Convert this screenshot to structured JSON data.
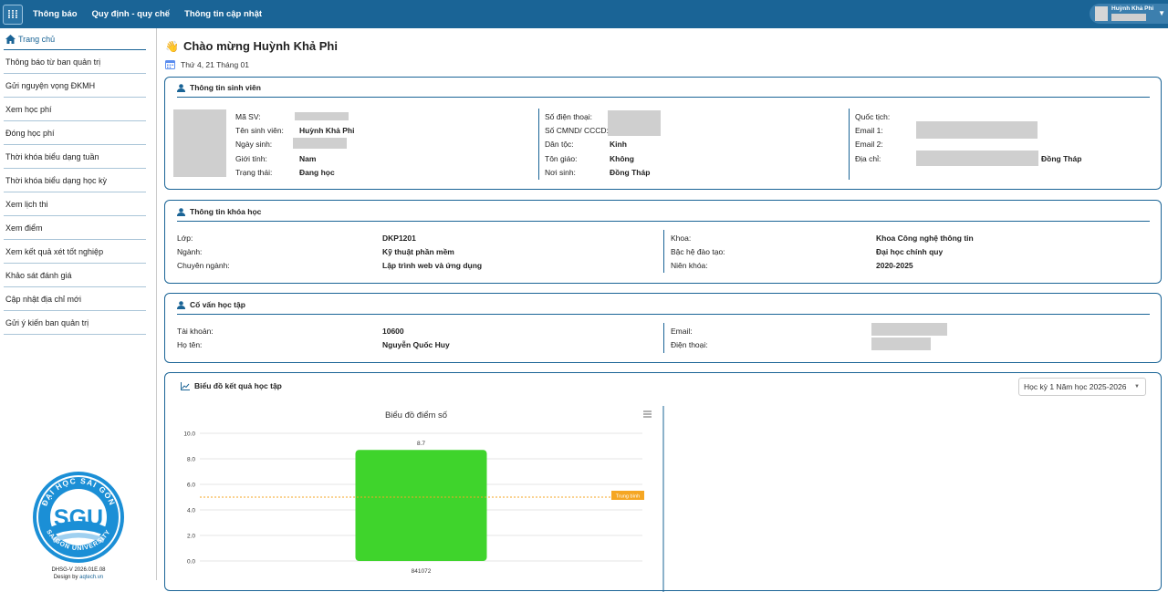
{
  "topbar": {
    "menu_icon": "grid-icon",
    "nav": [
      "Thông báo",
      "Quy định - quy chế",
      "Thông tin cập nhật"
    ],
    "user_name": "Huỳnh Khả Phi"
  },
  "sidebar": {
    "home": "Trang chủ",
    "items": [
      "Thông báo từ ban quản trị",
      "Gửi nguyện vọng ĐKMH",
      "Xem học phí",
      "Đóng học phí",
      "Thời khóa biểu dạng tuần",
      "Thời khóa biểu dạng học kỳ",
      "Xem lịch thi",
      "Xem điểm",
      "Xem kết quả xét tốt nghiệp",
      "Khảo sát đánh giá",
      "Cập nhật địa chỉ mới",
      "Gửi ý kiến ban quản trị"
    ],
    "logo_top": "ĐẠI HỌC SÀI GÒN",
    "logo_mid": "SGU",
    "logo_bottom": "SAIGON UNIVERSITY",
    "version": "DHSG-V 2026.01E.08",
    "design_prefix": "Design by ",
    "design_link": "aqtech.vn"
  },
  "welcome": {
    "title": "Chào mừng Huỳnh Khả Phi",
    "date": "Thứ 4, 21 Tháng 01"
  },
  "student": {
    "title": "Thông tin sinh viên",
    "col1": [
      {
        "label": "Mã SV:",
        "value": ""
      },
      {
        "label": "Tên sinh viên:",
        "value": "Huỳnh Khả Phi"
      },
      {
        "label": "Ngày sinh:",
        "value": ""
      },
      {
        "label": "Giới tính:",
        "value": "Nam"
      },
      {
        "label": "Trạng thái:",
        "value": "Đang học"
      }
    ],
    "col2": [
      {
        "label": "Số điện thoại:",
        "value": ""
      },
      {
        "label": "Số CMND/ CCCD:",
        "value": ""
      },
      {
        "label": "Dân tộc:",
        "value": "Kinh"
      },
      {
        "label": "Tôn giáo:",
        "value": "Không"
      },
      {
        "label": "Nơi sinh:",
        "value": "Đồng Tháp"
      }
    ],
    "col3": [
      {
        "label": "Quốc tịch:",
        "value": ""
      },
      {
        "label": "Email 1:",
        "value": ""
      },
      {
        "label": "Email 2:",
        "value": ""
      },
      {
        "label": "Địa chỉ:",
        "value": "Đồng Tháp"
      }
    ]
  },
  "course": {
    "title": "Thông tin khóa học",
    "left": [
      {
        "label": "Lớp:",
        "value": "DKP1201"
      },
      {
        "label": "Ngành:",
        "value": "Kỹ thuật phần mềm"
      },
      {
        "label": "Chuyên ngành:",
        "value": "Lập trình web và ứng dụng"
      }
    ],
    "right": [
      {
        "label": "Khoa:",
        "value": "Khoa Công nghệ thông tin"
      },
      {
        "label": "Bậc hệ đào tạo:",
        "value": "Đại học chính quy"
      },
      {
        "label": "Niên khóa:",
        "value": "2020-2025"
      }
    ]
  },
  "advisor": {
    "title": "Cố vấn học tập",
    "left": [
      {
        "label": "Tài khoản:",
        "value": "10600"
      },
      {
        "label": "Họ tên:",
        "value": "Nguyễn Quốc Huy"
      }
    ],
    "right": [
      {
        "label": "Email:",
        "value": ""
      },
      {
        "label": "Điện thoại:",
        "value": ""
      }
    ]
  },
  "results": {
    "title": "Biểu đồ kết quả học tập",
    "semester_select": "Học kỳ 1 Năm học 2025-2026"
  },
  "chart_data": {
    "type": "bar",
    "title": "Biểu đồ điểm số",
    "categories": [
      "841072"
    ],
    "values": [
      8.7
    ],
    "data_labels": [
      "8.7"
    ],
    "ylim": [
      0,
      10
    ],
    "yticks": [
      "0.0",
      "2.0",
      "4.0",
      "6.0",
      "8.0",
      "10.0"
    ],
    "bar_color": "#3fd42c",
    "reference_line": {
      "label": "Trung bình",
      "value": 5,
      "color": "#f5a623"
    },
    "grid": true
  },
  "colors": {
    "primary": "#1a6496",
    "accent": "#f5a623",
    "bar": "#3fd42c"
  }
}
